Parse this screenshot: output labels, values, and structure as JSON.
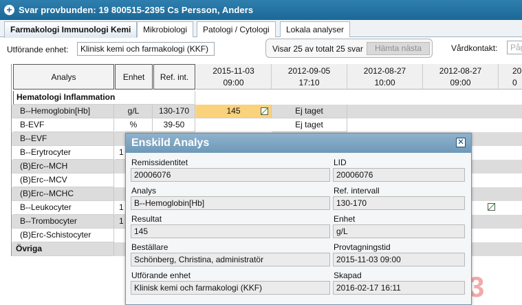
{
  "window": {
    "title": "Svar provbunden: 19 800515-2395 Cs Persson, Anders"
  },
  "tabs": [
    "Farmakologi Immunologi Kemi",
    "Mikrobiologi",
    "Patologi / Cytologi",
    "Lokala analyser"
  ],
  "toolbar": {
    "unit_label": "Utförande enhet:",
    "unit_value": "Klinisk kemi och farmakologi (KKF)",
    "showing_text": "Visar 25 av totalt 25 svar",
    "fetch_next": "Hämta nästa",
    "contact_label": "Vårdkontakt:",
    "contact_placeholder": "Påg"
  },
  "grid": {
    "headers": {
      "analys": "Analys",
      "enhet": "Enhet",
      "ref": "Ref. int."
    },
    "dates": [
      {
        "date": "2015-11-03",
        "time": "09:00"
      },
      {
        "date": "2012-09-05",
        "time": "17:10"
      },
      {
        "date": "2012-08-27",
        "time": "10:00"
      },
      {
        "date": "2012-08-27",
        "time": "09:00"
      },
      {
        "date": "20",
        "time": "0"
      }
    ],
    "rows": [
      {
        "name": "Hematologi Inflammation",
        "group": true
      },
      {
        "name": "B--Hemoglobin[Hb]",
        "unit": "g/L",
        "ref": "130-170",
        "v1": "145",
        "v2": "Ej taget"
      },
      {
        "name": "B-EVF",
        "unit": "%",
        "ref": "39-50",
        "v2": "Ej taget"
      },
      {
        "name": "B--EVF"
      },
      {
        "name": "B--Erytrocyter",
        "unit": "1"
      },
      {
        "name": "(B)Erc--MCH"
      },
      {
        "name": "(B)Erc--MCV"
      },
      {
        "name": "(B)Erc--MCHC"
      },
      {
        "name": "B--Leukocyter",
        "unit": "1"
      },
      {
        "name": "B--Trombocyter",
        "unit": "1"
      },
      {
        "name": "(B)Erc-Schistocyter"
      },
      {
        "name": "Övriga",
        "group": true
      }
    ]
  },
  "dialog": {
    "title": "Enskild Analys",
    "remiss_label": "Remissidentitet",
    "remiss_value": "20006076",
    "lid_label": "LID",
    "lid_value": "20006076",
    "analys_label": "Analys",
    "analys_value": "B--Hemoglobin[Hb]",
    "ref_label": "Ref. intervall",
    "ref_value": "130-170",
    "resultat_label": "Resultat",
    "resultat_value": "145",
    "enhet_label": "Enhet",
    "enhet_value": "g/L",
    "bestallare_label": "Beställare",
    "bestallare_value": "Schönberg, Christina, administratör",
    "provtid_label": "Provtagningstid",
    "provtid_value": "2015-11-03 09:00",
    "utforande_label": "Utförande enhet",
    "utforande_value": "Klinisk kemi och farmakologi (KKF)",
    "skapad_label": "Skapad",
    "skapad_value": "2016-02-17 16:11"
  },
  "background_digit": "3",
  "colors": {
    "titlebar": "#1a6897",
    "highlight": "#fad27b",
    "dialog_header": "#7aa2c0"
  }
}
